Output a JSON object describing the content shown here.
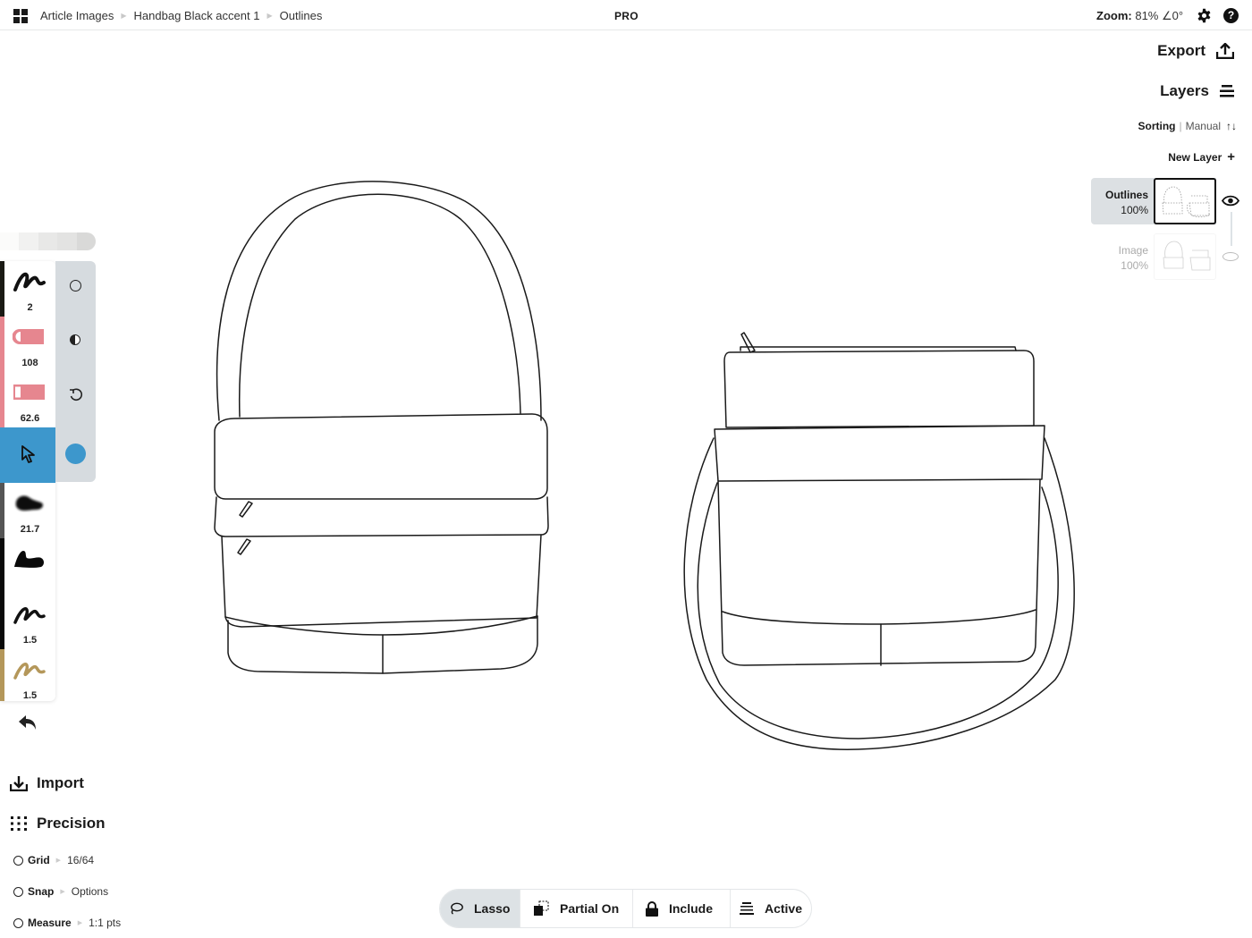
{
  "topbar": {
    "apps_icon": "grid-icon",
    "breadcrumb": [
      "Article Images",
      "Handbag Black accent 1",
      "Outlines"
    ],
    "plan_badge": "PRO",
    "zoom_label": "Zoom:",
    "zoom_value": "81%",
    "rotation_value": "∠0°",
    "settings_icon": "gear-icon",
    "help_icon": "help-icon"
  },
  "right_panel": {
    "export_label": "Export",
    "layers_label": "Layers",
    "sorting_label": "Sorting",
    "sorting_value": "Manual",
    "sorting_icon": "↑↓",
    "new_layer_label": "New Layer",
    "new_layer_icon": "+",
    "layers": [
      {
        "name": "Outlines",
        "opacity": "100%",
        "active": true,
        "visible": true
      },
      {
        "name": "Image",
        "opacity": "100%",
        "active": false,
        "visible": false
      }
    ]
  },
  "left_toolbar": {
    "color_swatches": [
      "#fbfbfa",
      "#f1f1f0",
      "#e8e8e7",
      "#e3e3e2",
      "#d9d9d8"
    ],
    "tools": [
      {
        "name": "pen",
        "value": "2",
        "color": "#1a1a14"
      },
      {
        "name": "eraser-rounded",
        "value": "108",
        "color": "#e6868f"
      },
      {
        "name": "eraser-square",
        "value": "62.6",
        "color": "#e6868f"
      },
      {
        "name": "select",
        "value": "",
        "color": "#3d97cc",
        "selected": true
      },
      {
        "name": "airbrush",
        "value": "21.7",
        "color": "#555555"
      },
      {
        "name": "fill-brush",
        "value": "",
        "color": "#0a0a0a"
      },
      {
        "name": "pen-black",
        "value": "1.5",
        "color": "#0a0a0a"
      },
      {
        "name": "pen-gold",
        "value": "1.5",
        "color": "#b4975a"
      }
    ],
    "side_controls": [
      "opacity-ring",
      "contrast-toggle",
      "rotate-reset",
      "active-color"
    ],
    "active_color": "#3d97cc"
  },
  "bottom_left": {
    "import_label": "Import",
    "precision_label": "Precision",
    "options": [
      {
        "label": "Grid",
        "value": "16/64"
      },
      {
        "label": "Snap",
        "value": "Options"
      },
      {
        "label": "Measure",
        "value": "1:1 pts"
      }
    ]
  },
  "bottom_bar": {
    "lasso": "Lasso",
    "partial": "Partial On",
    "include": "Include",
    "active": "Active"
  }
}
